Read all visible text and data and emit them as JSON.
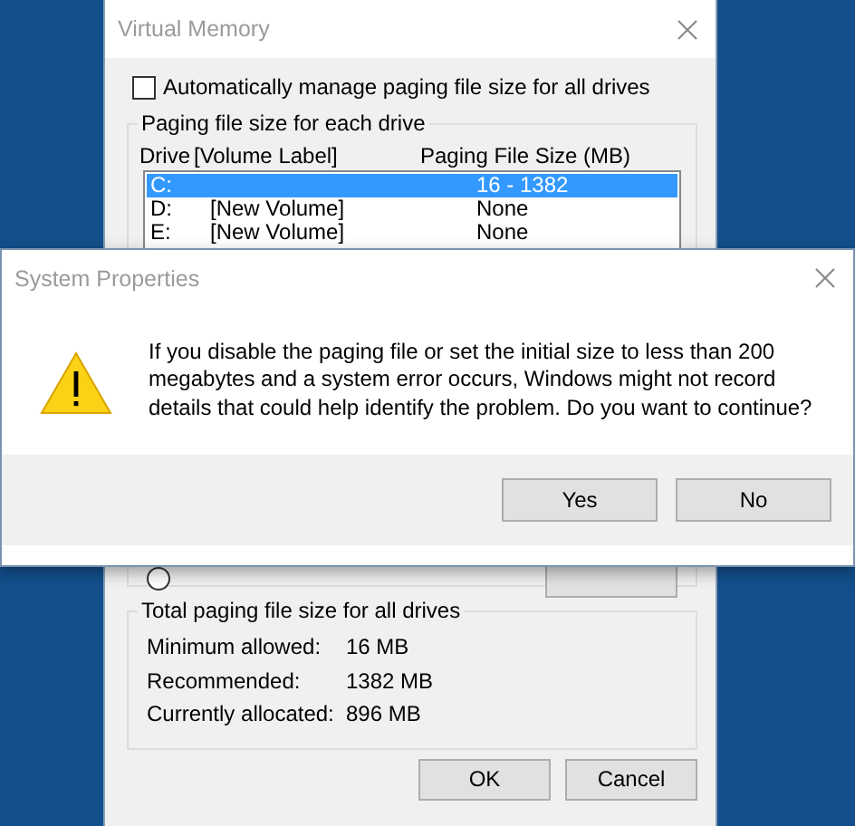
{
  "virtual_memory": {
    "title": "Virtual Memory",
    "auto_manage": {
      "label": "Automatically manage paging file size for all drives",
      "checked": false
    },
    "drive_group": {
      "title": "Paging file size for each drive",
      "columns": [
        "Drive",
        "[Volume Label]",
        "Paging File Size (MB)"
      ],
      "rows": [
        {
          "drive": "C:",
          "size": "16 - 1382",
          "selected": true
        },
        {
          "drive": "D:",
          "volume_label": "[New Volume]",
          "size": "None",
          "selected": false
        },
        {
          "drive": "E:",
          "volume_label": "[New Volume]",
          "size": "None",
          "selected": false
        }
      ],
      "size_option": {
        "selected": false
      }
    },
    "totals_group": {
      "title": "Total paging file size for all drives",
      "rows": [
        {
          "label": "Minimum allowed:",
          "value": "16 MB"
        },
        {
          "label": "Recommended:",
          "value": "1382 MB"
        },
        {
          "label": "Currently allocated:",
          "value": "896 MB"
        }
      ]
    },
    "buttons": [
      "OK",
      "Cancel"
    ]
  },
  "dialog": {
    "title": "System Properties",
    "kind": "warning",
    "message": "If you disable the paging file or set the initial size to less than 200 megabytes and a system error occurs, Windows might not record details that could help identify the problem. Do you want to continue?",
    "buttons": [
      "Yes",
      "No"
    ]
  }
}
